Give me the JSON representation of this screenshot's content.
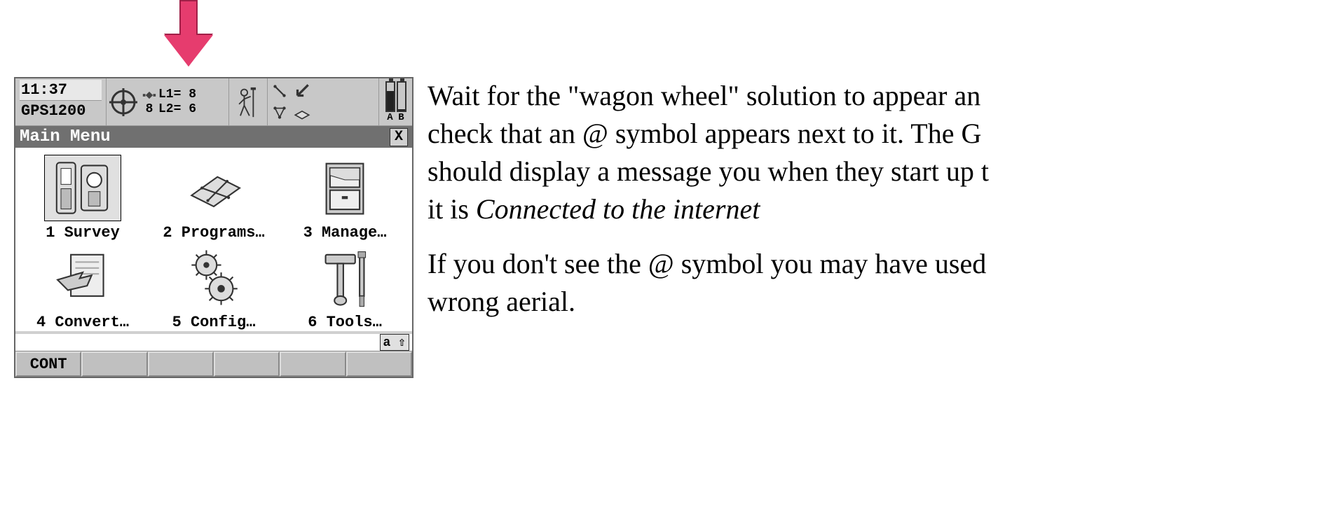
{
  "annotation": {
    "arrow_color": "#e63c6e"
  },
  "device": {
    "status": {
      "time": "11:37",
      "model": "GPS1200",
      "tracked": "8",
      "l1": "L1= 8",
      "l2": "L2= 6",
      "battery_letters": "A B"
    },
    "title": "Main Menu",
    "close": "X",
    "menu": [
      {
        "num": "1",
        "label": "Survey",
        "icon": "survey-icon",
        "selected": true
      },
      {
        "num": "2",
        "label": "Programs…",
        "icon": "programs-icon",
        "selected": false
      },
      {
        "num": "3",
        "label": "Manage…",
        "icon": "manage-icon",
        "selected": false
      },
      {
        "num": "4",
        "label": "Convert…",
        "icon": "convert-icon",
        "selected": false
      },
      {
        "num": "5",
        "label": "Config…",
        "icon": "config-icon",
        "selected": false
      },
      {
        "num": "6",
        "label": "Tools…",
        "icon": "tools-icon",
        "selected": false
      }
    ],
    "mode": "a ⇧",
    "softkeys": [
      "CONT",
      "",
      "",
      "",
      "",
      ""
    ]
  },
  "instructions": {
    "p1_a": " Wait for the \"wagon wheel\" solution to appear an",
    "p1_b": "check that an @ symbol appears next to it. The G",
    "p1_c": "should display a message you when they start up t",
    "p1_d": "it is ",
    "p1_em": "Connected to the internet",
    "p2_a": "If you don't see the @ symbol you may have used",
    "p2_b": "wrong aerial."
  }
}
